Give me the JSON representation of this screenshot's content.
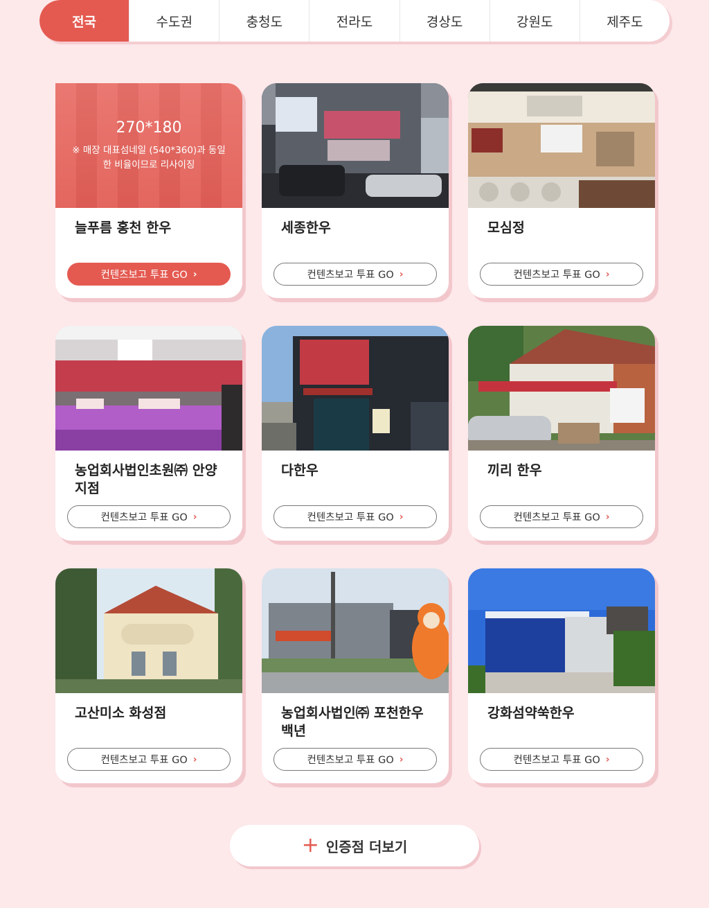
{
  "tabs": [
    {
      "label": "전국",
      "active": true
    },
    {
      "label": "수도권"
    },
    {
      "label": "충청도"
    },
    {
      "label": "전라도"
    },
    {
      "label": "경상도"
    },
    {
      "label": "강원도"
    },
    {
      "label": "제주도"
    }
  ],
  "placeholder": {
    "size": "270*180",
    "note": "※ 매장 대표섬네일 (540*360)과 동일한 비율이므로 리사이징"
  },
  "vote_label": "컨텐츠보고 투표 GO",
  "stores": [
    {
      "name": "늘푸름 홍천 한우"
    },
    {
      "name": "세종한우"
    },
    {
      "name": "모심정"
    },
    {
      "name": "농업회사법인초원㈜ 안양지점"
    },
    {
      "name": "다한우"
    },
    {
      "name": "끼리 한우"
    },
    {
      "name": "고산미소 화성점"
    },
    {
      "name": "농업회사법인㈜ 포천한우백년"
    },
    {
      "name": "강화섬약쑥한우"
    }
  ],
  "more_label": "인증점 더보기",
  "colors": {
    "accent": "#e45a51",
    "background": "#fde8ea"
  }
}
